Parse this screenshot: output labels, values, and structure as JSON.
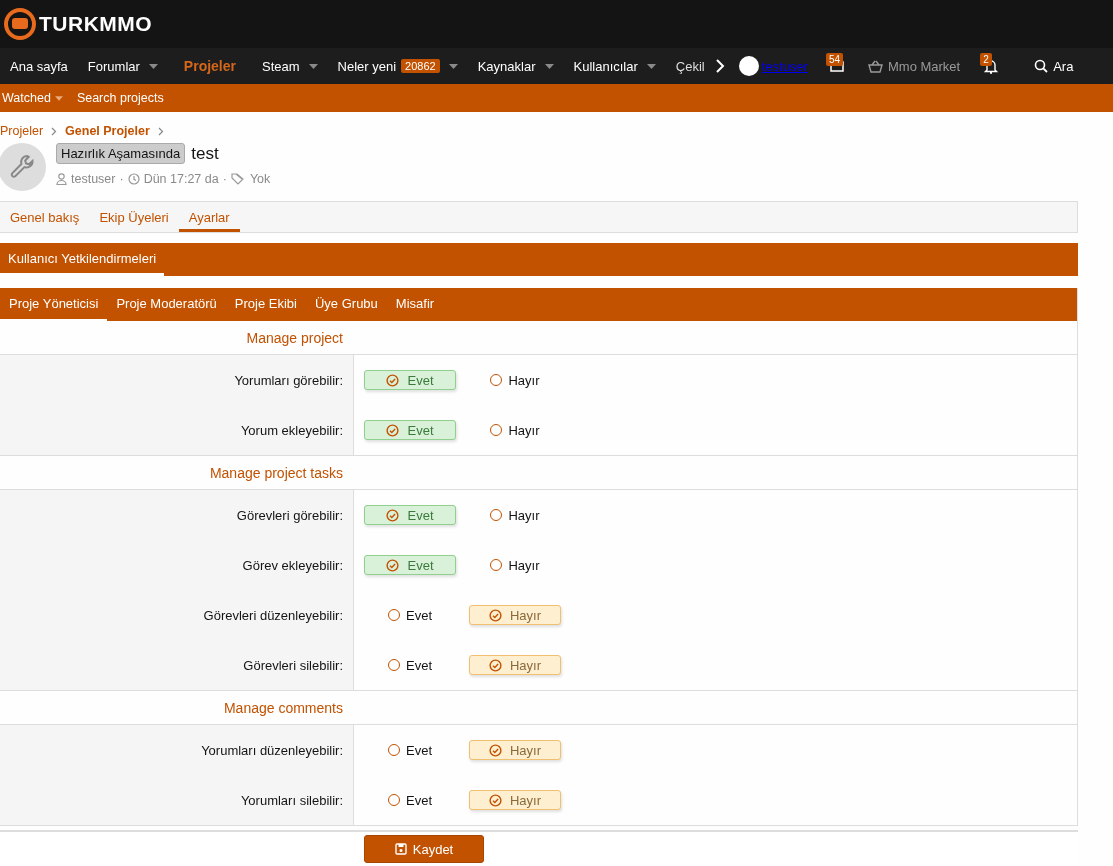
{
  "logo": {
    "text": "TURKMMO"
  },
  "nav": [
    {
      "label": "Ana sayfa",
      "selected": false,
      "caret": false
    },
    {
      "label": "Forumlar",
      "selected": false,
      "caret": true
    },
    {
      "label": "Projeler",
      "selected": true,
      "caret": false
    },
    {
      "label": "Steam",
      "selected": false,
      "caret": true
    },
    {
      "label": "Neler yeni",
      "selected": false,
      "caret": true,
      "badge": "20862"
    },
    {
      "label": "Kaynaklar",
      "selected": false,
      "caret": true
    },
    {
      "label": "Kullanıcılar",
      "selected": false,
      "caret": true
    },
    {
      "label": "Çekil",
      "selected": false,
      "caret": false
    }
  ],
  "user_nav": {
    "username": "testuser",
    "inbox_badge": "54",
    "market": "Mmo Market",
    "alerts_badge": "2",
    "search": "Ara"
  },
  "subnav": [
    {
      "label": "Watched",
      "caret": true
    },
    {
      "label": "Search projects",
      "caret": false
    }
  ],
  "breadcrumbs": [
    {
      "label": "Projeler",
      "bold": false
    },
    {
      "label": "Genel Projeler",
      "bold": true
    }
  ],
  "project": {
    "prefix": "Hazırlık Aşamasında",
    "title": "test",
    "author": "testuser",
    "time": "Dün 17:27 da",
    "tags": "Yok",
    "separator": "·"
  },
  "tabs": [
    {
      "label": "Genel bakış",
      "selected": false
    },
    {
      "label": "Ekip Üyeleri",
      "selected": false
    },
    {
      "label": "Ayarlar",
      "selected": true
    }
  ],
  "section_tabs": [
    {
      "label": "Kullanıcı Yetkilendirmeleri",
      "selected": true
    }
  ],
  "role_tabs": [
    {
      "label": "Proje Yöneticisi",
      "selected": true
    },
    {
      "label": "Proje Moderatörü",
      "selected": false
    },
    {
      "label": "Proje Ekibi",
      "selected": false
    },
    {
      "label": "Üye Grubu",
      "selected": false
    },
    {
      "label": "Misafir",
      "selected": false
    }
  ],
  "groups": [
    {
      "title": "Manage project",
      "rows": [
        {
          "label": "Yorumları görebilir:",
          "options": [
            {
              "label": "Evet",
              "selected": true
            },
            {
              "label": "Hayır",
              "selected": false
            }
          ]
        },
        {
          "label": "Yorum ekleyebilir:",
          "options": [
            {
              "label": "Evet",
              "selected": true
            },
            {
              "label": "Hayır",
              "selected": false
            }
          ]
        }
      ]
    },
    {
      "title": "Manage project tasks",
      "rows": [
        {
          "label": "Görevleri görebilir:",
          "options": [
            {
              "label": "Evet",
              "selected": true
            },
            {
              "label": "Hayır",
              "selected": false
            }
          ]
        },
        {
          "label": "Görev ekleyebilir:",
          "options": [
            {
              "label": "Evet",
              "selected": true
            },
            {
              "label": "Hayır",
              "selected": false
            }
          ]
        },
        {
          "label": "Görevleri düzenleyebilir:",
          "options": [
            {
              "label": "Evet",
              "selected": false
            },
            {
              "label": "Hayır",
              "selected": true
            }
          ]
        },
        {
          "label": "Görevleri silebilir:",
          "options": [
            {
              "label": "Evet",
              "selected": false
            },
            {
              "label": "Hayır",
              "selected": true
            }
          ]
        }
      ]
    },
    {
      "title": "Manage comments",
      "rows": [
        {
          "label": "Yorumları düzenleyebilir:",
          "options": [
            {
              "label": "Evet",
              "selected": false
            },
            {
              "label": "Hayır",
              "selected": true
            }
          ]
        },
        {
          "label": "Yorumları silebilir:",
          "options": [
            {
              "label": "Evet",
              "selected": false
            },
            {
              "label": "Hayır",
              "selected": true
            }
          ]
        }
      ]
    }
  ],
  "save_button": "Kaydet"
}
